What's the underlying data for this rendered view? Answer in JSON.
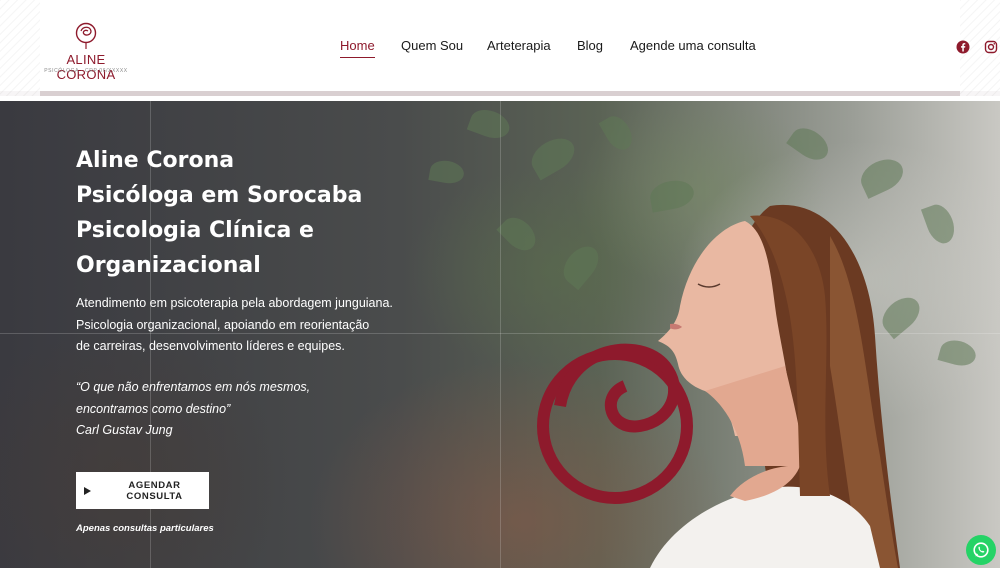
{
  "header": {
    "logo": {
      "name": "ALINE CORONA",
      "subtitle": "PSICÓLOGA · CRP 06/XXXXX"
    },
    "nav": [
      {
        "label": "Home",
        "active": true
      },
      {
        "label": "Quem Sou"
      },
      {
        "label": "Arteterapia"
      },
      {
        "label": "Blog"
      },
      {
        "label": "Agende uma consulta"
      }
    ],
    "social": [
      "facebook-icon",
      "instagram-icon"
    ]
  },
  "hero": {
    "title_lines": [
      "Aline Corona",
      "Psicóloga em Sorocaba",
      "Psicologia Clínica e",
      "Organizacional"
    ],
    "description_lines": [
      "Atendimento em psicoterapia pela abordagem junguiana.",
      "Psicologia organizacional, apoiando em reorientação",
      "de carreiras, desenvolvimento líderes e equipes."
    ],
    "quote_lines": [
      "“O que não enfrentamos em nós mesmos,",
      "encontramos como destino”",
      "Carl Gustav Jung"
    ],
    "cta_label": "AGENDAR CONSULTA",
    "note": "Apenas consultas particulares"
  },
  "colors": {
    "brand": "#8e1a2c",
    "whatsapp": "#25d366",
    "header_border": "#d9cfd1"
  }
}
